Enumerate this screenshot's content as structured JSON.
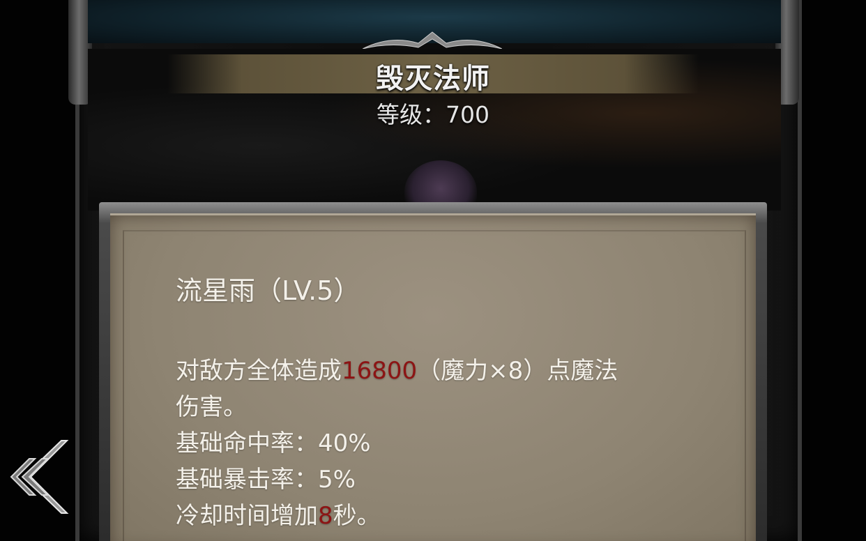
{
  "hero": {
    "class_name": "毁灭法师",
    "level_label": "等级：",
    "level_value": "700"
  },
  "skill": {
    "title": "流星雨（LV.5）",
    "desc_part1": "对敌方全体造成",
    "damage_value": "16800",
    "desc_part2": "（魔力×8）点魔法",
    "desc_line2": "伤害。",
    "hit_rate": "基础命中率：40%",
    "crit_rate": "基础暴击率：5%",
    "cooldown_prefix": "冷却时间增加",
    "cooldown_value": "8",
    "cooldown_suffix": "秒。"
  },
  "colors": {
    "highlight": "#8c1414",
    "text": "#f4f1ea",
    "parchment": "#8e8472"
  },
  "icons": {
    "back": "double-chevron-left-icon"
  }
}
